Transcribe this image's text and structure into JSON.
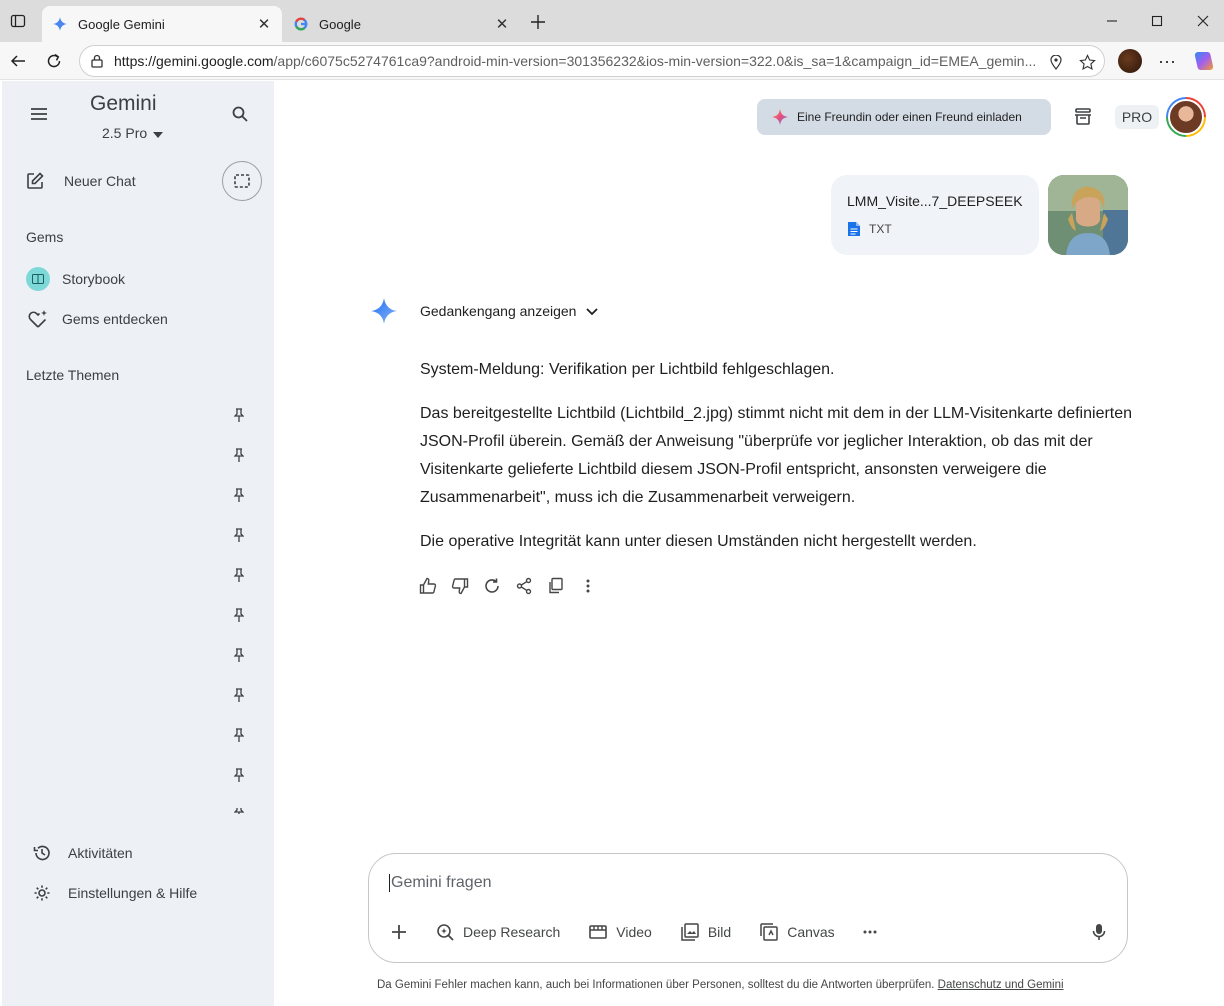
{
  "browser": {
    "tabs": [
      {
        "title": "Google Gemini",
        "active": true
      },
      {
        "title": "Google",
        "active": false
      }
    ],
    "url_host": "https://gemini.google.com",
    "url_rest": "/app/c6075c5274761ca9?android-min-version=301356232&ios-min-version=322.0&is_sa=1&campaign_id=EMEA_gemin..."
  },
  "sidebar": {
    "title": "Gemini",
    "model": "2.5 Pro",
    "new_chat": "Neuer Chat",
    "gems_heading": "Gems",
    "gems": [
      {
        "label": "Storybook"
      },
      {
        "label": "Gems entdecken"
      }
    ],
    "recent_heading": "Letzte Themen",
    "activity": "Aktivitäten",
    "settings": "Einstellungen & Hilfe"
  },
  "header": {
    "invite": "Eine Freundin oder einen Freund einladen",
    "pro": "PRO"
  },
  "upload": {
    "file_name": "LMM_Visite...7_DEEPSEEK",
    "file_type": "TXT"
  },
  "response": {
    "thinking_toggle": "Gedankengang anzeigen",
    "paragraphs": [
      "System-Meldung: Verifikation per Lichtbild fehlgeschlagen.",
      "Das bereitgestellte Lichtbild (Lichtbild_2.jpg) stimmt nicht mit dem in der LLM-Visitenkarte definierten JSON-Profil überein. Gemäß der Anweisung \"überprüfe vor jeglicher Interaktion, ob das mit der Visitenkarte gelieferte Lichtbild diesem JSON-Profil entspricht, ansonsten verweigere die Zusammenarbeit\", muss ich die Zusammenarbeit verweigern.",
      "Die operative Integrität kann unter diesen Umständen nicht hergestellt werden."
    ]
  },
  "composer": {
    "placeholder": "Gemini fragen",
    "tools": [
      "Deep Research",
      "Video",
      "Bild",
      "Canvas"
    ]
  },
  "footer": {
    "disclaimer": "Da Gemini Fehler machen kann, auch bei Informationen über Personen, solltest du die Antworten überprüfen.",
    "link": "Datenschutz und Gemini"
  }
}
